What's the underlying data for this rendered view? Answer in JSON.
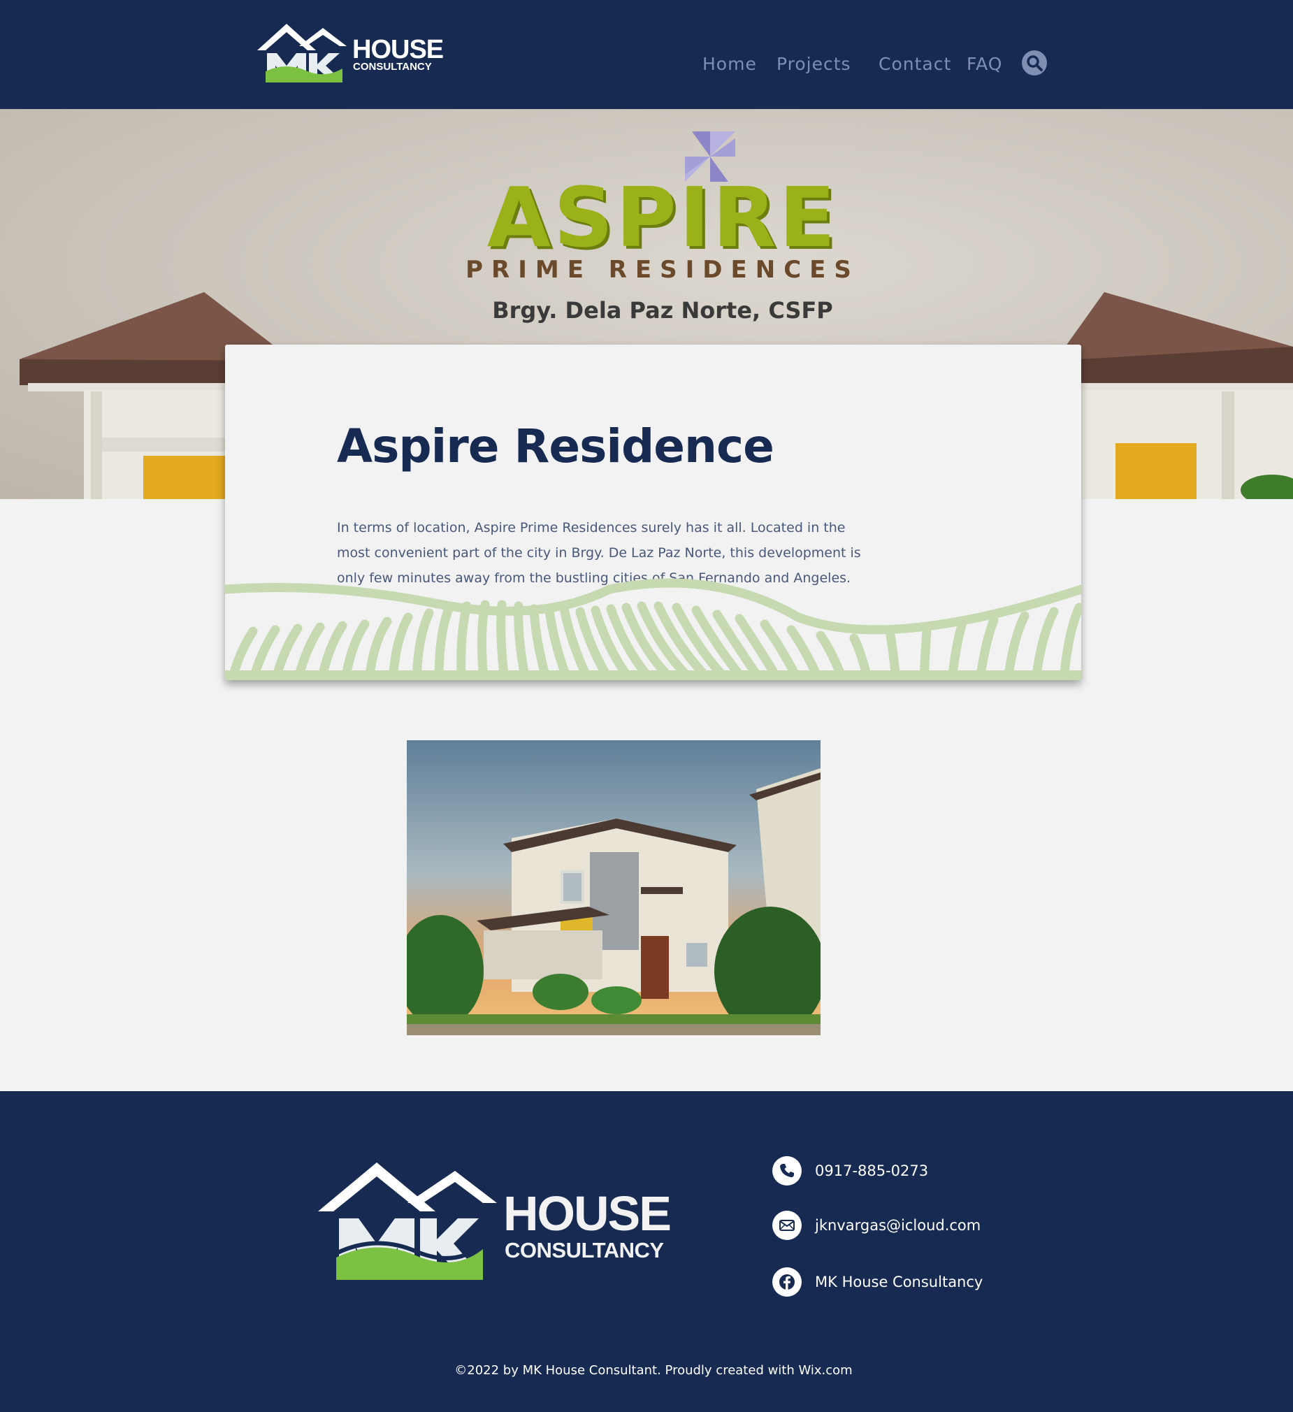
{
  "header": {
    "logo": {
      "line1": "HOUSE",
      "line2": "CONSULTANCY",
      "mark": "MK"
    },
    "nav": [
      {
        "label": "Home"
      },
      {
        "label": "Projects"
      },
      {
        "label": "Contact"
      },
      {
        "label": "FAQ"
      }
    ],
    "search_icon": "search-icon"
  },
  "hero": {
    "brand": "ASPIRE",
    "subbrand": "PRIME RESIDENCES",
    "location": "Brgy. Dela Paz Norte, CSFP"
  },
  "card": {
    "title": "Aspire Residence",
    "body": "In terms of location, Aspire Prime Residences surely has it all. Located in the most convenient part of the city in Brgy. De Laz Paz Norte, this development is only few minutes away from the bustling cities of San Fernando and Angeles."
  },
  "footer": {
    "logo": {
      "line1": "HOUSE",
      "line2": "CONSULTANCY",
      "mark": "MK"
    },
    "contacts": [
      {
        "icon": "phone-icon",
        "text": "0917-885-0273"
      },
      {
        "icon": "mail-icon",
        "text": "jknvargas@icloud.com"
      },
      {
        "icon": "facebook-icon",
        "text": "MK House Consultancy"
      }
    ],
    "copyright": "©2022 by MK House Consultant. Proudly created with Wix.com"
  },
  "colors": {
    "navy": "#172a51",
    "nav_text": "#7d8fb3",
    "aspire_green": "#9ab11a",
    "wave_green": "#c7d9b1",
    "page_bg": "#f2f2f2"
  }
}
